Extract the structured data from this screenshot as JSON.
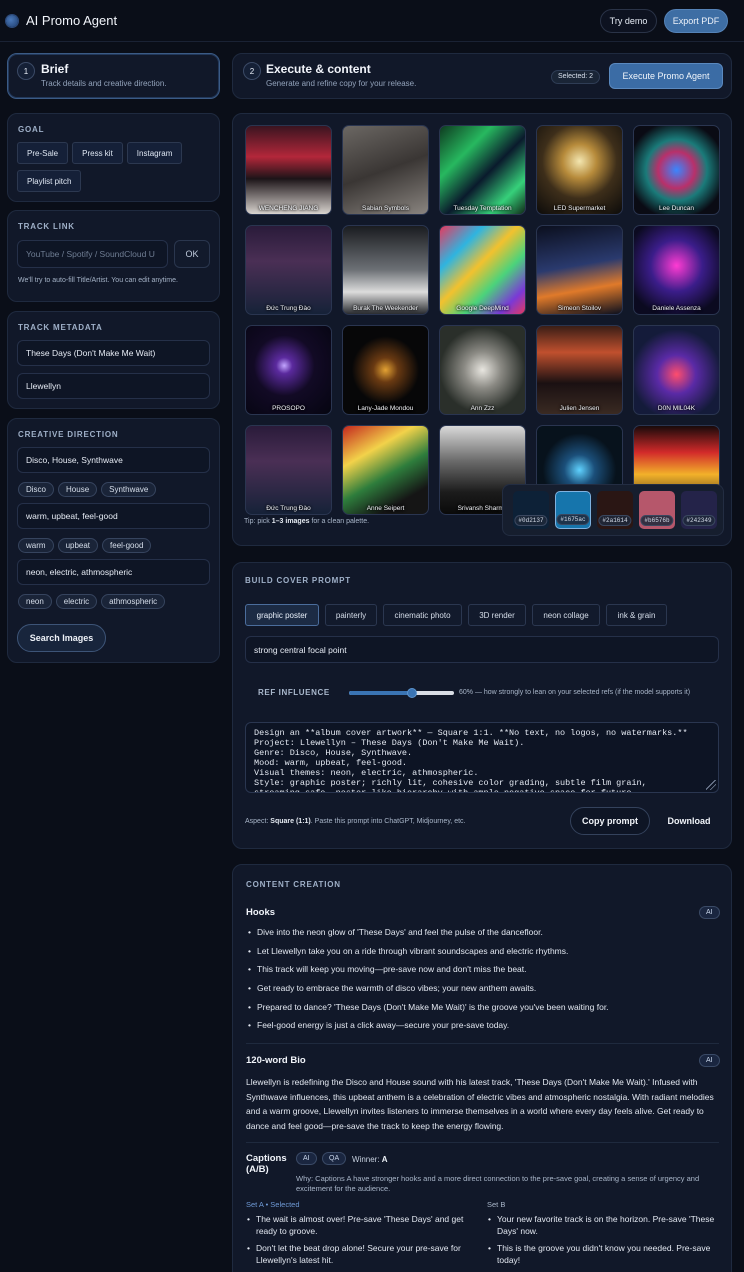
{
  "header": {
    "app_title": "AI Promo Agent",
    "try_demo": "Try demo",
    "export_pdf": "Export PDF"
  },
  "steps": {
    "brief": {
      "num": "1",
      "title": "Brief",
      "subtitle": "Track details and creative direction."
    },
    "execute": {
      "num": "2",
      "title": "Execute & content",
      "subtitle": "Generate and refine copy for your release.",
      "selected": "Selected: 2",
      "run": "Execute Promo Agent"
    }
  },
  "goal": {
    "label": "GOAL",
    "options": [
      "Pre-Sale",
      "Press kit",
      "Instagram",
      "Playlist pitch"
    ]
  },
  "track_link": {
    "label": "TRACK LINK",
    "placeholder": "YouTube / Spotify / SoundCloud U",
    "ok": "OK",
    "hint": "We'll try to auto-fill Title/Artist. You can edit anytime."
  },
  "metadata": {
    "label": "TRACK METADATA",
    "title": "These Days (Don't Make Me Wait)",
    "artist": "Llewellyn"
  },
  "creative": {
    "label": "CREATIVE DIRECTION",
    "genres_input": "Disco, House, Synthwave",
    "genres": [
      "Disco",
      "House",
      "Synthwave"
    ],
    "mood_input": "warm, upbeat, feel-good",
    "moods": [
      "warm",
      "upbeat",
      "feel-good"
    ],
    "themes_input": "neon, electric, athmospheric",
    "themes": [
      "neon",
      "electric",
      "athmospheric"
    ],
    "search": "Search Images"
  },
  "gallery": {
    "images": [
      "WENCHENG JIANG",
      "Sabian Symbols",
      "Tuesday Temptation",
      "LED Supermarket",
      "Lee Duncan",
      "Đức Trung Đào",
      "Burak The Weekender",
      "Google DeepMind",
      "Simeon Stoilov",
      "Daniele Assenza",
      "PROSOPO",
      "Lany-Jade Mondou",
      "Ann Zzz",
      "Julien Jensen",
      "D0N MIL04K",
      "Đức Trung Đào",
      "Anne Seipert",
      "Srivansh Sharma",
      "",
      ""
    ],
    "tip_prefix": "Tip: pick ",
    "tip_bold": "1–3 images",
    "tip_suffix": " for a clean palette.",
    "palette": [
      "#0d2137",
      "#1675ac",
      "#2a1614",
      "#b6576b",
      "#242349"
    ]
  },
  "cover": {
    "label": "BUILD COVER PROMPT",
    "styles": [
      "graphic poster",
      "painterly",
      "cinematic photo",
      "3D render",
      "neon collage",
      "ink & grain"
    ],
    "focal": "strong central focal point",
    "ref_label": "REF INFLUENCE",
    "ref_value": 0.6,
    "ref_hint": "60% — how strongly to lean on your selected refs (if the model supports it)",
    "prompt": "Design an **album cover artwork** — Square 1:1. **No text, no logos, no watermarks.**\nProject: Llewellyn – These Days (Don't Make Me Wait).\nGenre: Disco, House, Synthwave.\nMood: warm, upbeat, feel-good.\nVisual themes: neon, electric, athmospheric.\nStyle: graphic poster; richly lit, cohesive color grading, subtle film grain,\nstreaming-safe, poster-like hierarchy with ample negative space for future",
    "aspect_prefix": "Aspect: ",
    "aspect_bold": "Square (1:1)",
    "aspect_suffix": ". Paste this prompt into ChatGPT, Midjourney, etc.",
    "copy": "Copy prompt",
    "download": "Download"
  },
  "content": {
    "label": "CONTENT CREATION",
    "hooks_title": "Hooks",
    "ai": "AI",
    "hooks": [
      "Dive into the neon glow of 'These Days' and feel the pulse of the dancefloor.",
      "Let Llewellyn take you on a ride through vibrant soundscapes and electric rhythms.",
      "This track will keep you moving—pre-save now and don't miss the beat.",
      "Get ready to embrace the warmth of disco vibes; your new anthem awaits.",
      "Prepared to dance? 'These Days (Don't Make Me Wait)' is the groove you've been waiting for.",
      "Feel-good energy is just a click away—secure your pre-save today."
    ],
    "bio_title": "120-word Bio",
    "bio": "Llewellyn is redefining the Disco and House sound with his latest track, 'These Days (Don't Make Me Wait).' Infused with Synthwave influences, this upbeat anthem is a celebration of electric vibes and atmospheric nostalgia. With radiant melodies and a warm groove, Llewellyn invites listeners to immerse themselves in a world where every day feels alive. Get ready to dance and feel good—pre-save the track to keep the energy flowing.",
    "captions_title": "Captions (A/B)",
    "qa": "QA",
    "winner_prefix": "Winner: ",
    "winner": "A",
    "why": "Why: Captions A have stronger hooks and a more direct connection to the pre-save goal, creating a sense of urgency and excitement for the audience.",
    "set_a_label": "Set A • Selected",
    "set_b_label": "Set B",
    "set_a": [
      "The wait is almost over! Pre-save 'These Days' and get ready to groove.",
      "Don't let the beat drop alone! Secure your pre-save for Llewellyn's latest hit."
    ],
    "set_b": [
      "Your new favorite track is on the horizon. Pre-save 'These Days' now.",
      "This is the groove you didn't know you needed. Pre-save today!"
    ]
  }
}
